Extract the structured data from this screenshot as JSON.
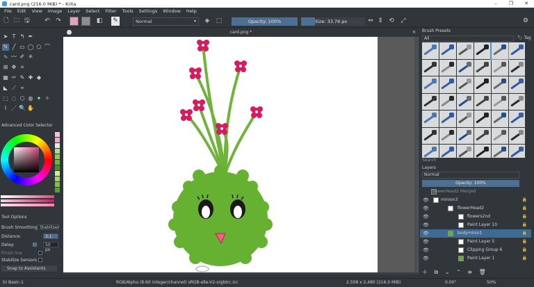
{
  "window": {
    "title": "card.png (216.0 MiB) * - Krita",
    "min": "–",
    "max": "❐",
    "close": "✕"
  },
  "menu": [
    "File",
    "Edit",
    "View",
    "Image",
    "Layer",
    "Select",
    "Filter",
    "Tools",
    "Settings",
    "Window",
    "Help"
  ],
  "toolbar": {
    "blend_mode": "Normal",
    "opacity_label": "Opacity: 100%",
    "size_label": "Size: 33.76 px",
    "size_fraction": 0.22
  },
  "document": {
    "tab_title": "card.png *"
  },
  "docker_color": {
    "title": "Advanced Color Selector"
  },
  "tool_options": {
    "title": "Tool Options",
    "brush_smoothing_label": "Brush Smoothing:",
    "brush_smoothing_value": "Stabilizer",
    "distance_label": "Distance:",
    "distance_value": "3.1",
    "delay_label": "Delay:",
    "delay_value": "50 px",
    "finish_line_label": "Finish line",
    "scalable_label": "Stabilize Sensors",
    "snap_label": "Snap to Assistants"
  },
  "brush_presets": {
    "title": "Brush Presets",
    "filter": "All",
    "tag_label": "Tag",
    "search_placeholder": "Search"
  },
  "layers": {
    "title": "Layers",
    "blend_mode": "Normal",
    "opacity_label": "Opacity: 100%",
    "items": [
      {
        "name": "flowerHead2 Merged",
        "indent": 18
      },
      {
        "name": "minion3",
        "indent": 30
      },
      {
        "name": "flowerHead2",
        "indent": 54
      },
      {
        "name": "flowers2nd",
        "indent": 68
      },
      {
        "name": "Paint Layer 10",
        "indent": 68
      },
      {
        "name": "bodyminio1",
        "indent": 54
      },
      {
        "name": "Paint Layer 5",
        "indent": 68
      },
      {
        "name": "Clipping Group 6",
        "indent": 68
      },
      {
        "name": "Paint Layer 1",
        "indent": 68
      }
    ]
  },
  "status": {
    "brush": "b) Basic-1",
    "colorspace": "RGB/Alpha (8-bit integer/channel)  sRGB-elle-V2-srgbtrc.icc",
    "dims": "2,508 x 2,480 (216.0 MiB)",
    "rotation": "0.00°",
    "zoom": "50%"
  },
  "colors": {
    "accent": "#4d6f93",
    "panel": "#31363b",
    "fuzz_green": "#66b032",
    "flower_pink": "#d81b60"
  }
}
